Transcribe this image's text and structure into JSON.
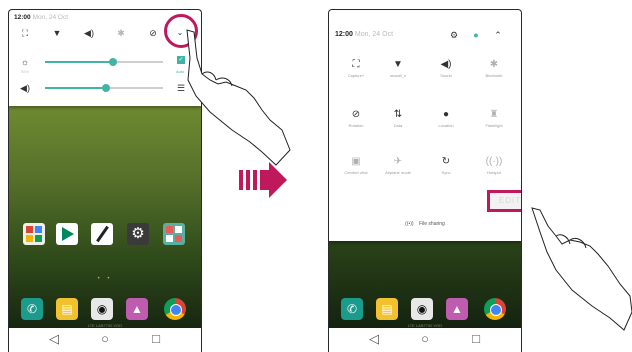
{
  "left_phone": {
    "clock": "12:00",
    "date": "Mon, 24 Oct",
    "quick_icons": [
      "screen-capture-icon",
      "wifi-icon",
      "sound-icon",
      "bluetooth-icon",
      "rotation-icon"
    ],
    "brightness_value": 0.58,
    "volume_value": 0.52,
    "brightness_small": "55%",
    "auto_label": "Auto",
    "nav": {
      "back": "◁",
      "home": "○",
      "recent": "□"
    },
    "carrier": "LTE LAB7700 VOD"
  },
  "right_phone": {
    "clock": "12:00",
    "date": "Mon, 24 Oct",
    "tiles": [
      {
        "label": "Capture+",
        "icon": "⛶",
        "on": true
      },
      {
        "label": "mcsoft_n",
        "icon": "▼",
        "on": true
      },
      {
        "label": "Sound",
        "icon": "◀)",
        "on": true
      },
      {
        "label": "Bluetooth",
        "icon": "✱",
        "on": false
      },
      {
        "label": "Rotation",
        "icon": "⊘",
        "on": true
      },
      {
        "label": "Data",
        "icon": "⇅",
        "on": true
      },
      {
        "label": "Location",
        "icon": "●",
        "on": true
      },
      {
        "label": "Flashlight",
        "icon": "♜",
        "on": false
      },
      {
        "label": "Comfort view",
        "icon": "▣",
        "on": false
      },
      {
        "label": "Airplane mode",
        "icon": "✈",
        "on": false
      },
      {
        "label": "Sync",
        "icon": "↻",
        "on": true
      },
      {
        "label": "Hotspot",
        "icon": "((·))",
        "on": false
      }
    ],
    "edit_label": "EDIT",
    "share_label": "File sharing",
    "nav": {
      "back": "◁",
      "home": "○",
      "recent": "□"
    },
    "carrier": "LTE LAB7700 VOD"
  },
  "colors": {
    "accent": "#43b3a5",
    "highlight": "#c0185c"
  }
}
